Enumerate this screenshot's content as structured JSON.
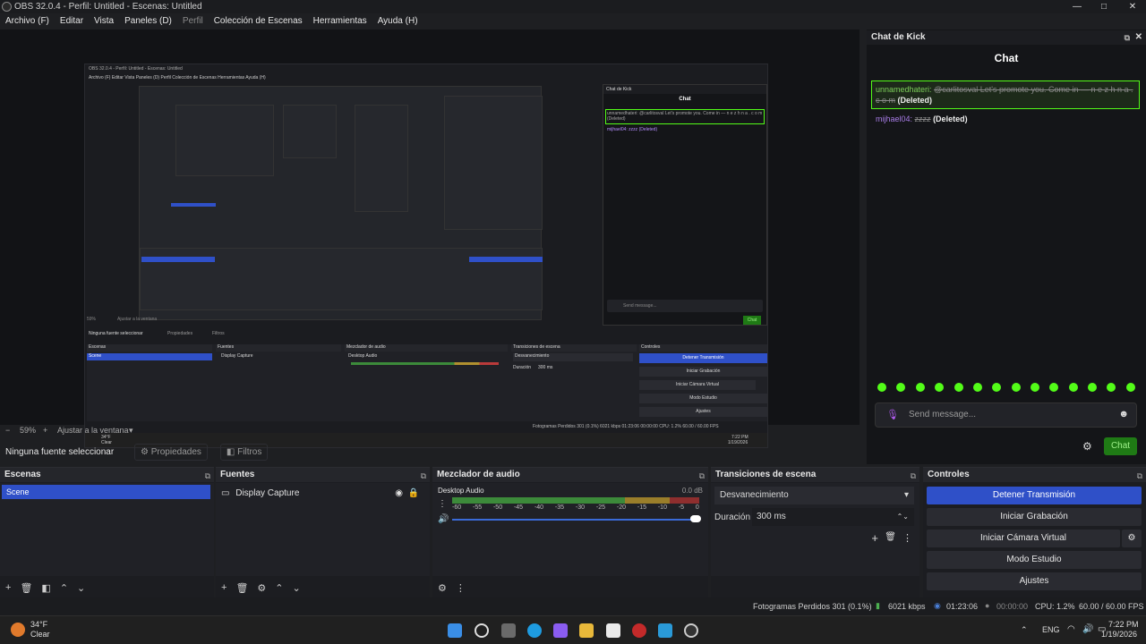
{
  "window": {
    "title": "OBS 32.0.4 - Perfil: Untitled - Escenas: Untitled",
    "minimize_icon": "minimize-icon",
    "maximize_icon": "maximize-icon",
    "close_icon": "close-icon"
  },
  "menu": {
    "archivo": "Archivo (F)",
    "editar": "Editar",
    "vista": "Vista",
    "paneles": "Paneles (D)",
    "perfil": "Perfil",
    "coleccion": "Colección de Escenas",
    "herramientas": "Herramientas",
    "ayuda": "Ayuda (H)"
  },
  "preview": {
    "zoom_label": "59%",
    "fit_label": "Ajustar a la ventana"
  },
  "source_toolbar": {
    "no_source": "Ninguna fuente seleccionar",
    "properties": "Propiedades",
    "filters": "Filtros"
  },
  "scenes": {
    "title": "Escenas",
    "items": [
      "Scene"
    ]
  },
  "sources": {
    "title": "Fuentes",
    "items": [
      "Display Capture"
    ]
  },
  "mixer": {
    "title": "Mezclador de audio",
    "channel": "Desktop Audio",
    "db": "0.0 dB",
    "ticks": [
      "-60",
      "-55",
      "-50",
      "-45",
      "-40",
      "-35",
      "-30",
      "-25",
      "-20",
      "-15",
      "-10",
      "-5",
      "0"
    ]
  },
  "transitions": {
    "title": "Transiciones de escena",
    "selected": "Desvanecimiento",
    "duration_label": "Duración",
    "duration_value": "300 ms"
  },
  "controls": {
    "title": "Controles",
    "stop_stream": "Detener Transmisión",
    "start_recording": "Iniciar Grabación",
    "virtual_cam": "Iniciar Cámara Virtual",
    "studio_mode": "Modo Estudio",
    "settings": "Ajustes"
  },
  "chat": {
    "dock_title": "Chat de Kick",
    "header": "Chat",
    "messages": [
      {
        "user": "unnamedhateri:",
        "text": "@carlitosval Let's promote you. Come in — n e z h n a . c o m",
        "tag": "(Deleted)"
      },
      {
        "user": "mijhael04:",
        "text": "zzzz",
        "tag": "(Deleted)"
      }
    ],
    "placeholder": "Send message...",
    "send_label": "Chat",
    "accent": "#53fc18"
  },
  "status": {
    "dropped": "Fotogramas Perdidos 301 (0.1%)",
    "bitrate": "6021 kbps",
    "live_time": "01:23:06",
    "rec_time": "00:00:00",
    "cpu": "CPU: 1.2%",
    "fps": "60.00 / 60.00 FPS"
  },
  "taskbar": {
    "temp": "34°F",
    "weather": "Clear",
    "lang": "ENG",
    "time": "7:22 PM",
    "date": "1/19/2026"
  },
  "nested": {
    "title": "OBS 32.0.4 - Perfil: Untitled - Escenas: Untitled",
    "menu": "Archivo (F)  Editar  Vista  Paneles (D)  Perfil  Colección de Escenas  Herramientas  Ayuda (H)",
    "chat_title": "Chat de Kick",
    "chat_header": "Chat",
    "chat_msg1": "unnamedhateri: @carlitosval Let's promote you. Come in — n e z h n a . c o m (Deleted)",
    "chat_msg2": "mijhael04: zzzz (Deleted)",
    "send": "Send message...",
    "chat_btn": "Chat",
    "no_source": "Ninguna fuente seleccionar",
    "props": "Propiedades",
    "filters": "Filtros",
    "scenes": "Escenas",
    "sources": "Fuentes",
    "mixer": "Mezclador de audio",
    "transitions": "Transiciones de escena",
    "controls": "Controles",
    "scene": "Scene",
    "display": "Display Capture",
    "desktop": "Desktop Audio",
    "fade": "Desvanecimiento",
    "duration": "Duración",
    "duration_value": "300 ms",
    "stop": "Detener Transmisión",
    "rec": "Iniciar Grabación",
    "vcam": "Iniciar Cámara Virtual",
    "studio": "Modo Estudio",
    "settings": "Ajustes",
    "status": "Fotogramas Perdidos 301 (0.1%)   6021 kbps   01:23:06   00:00:00   CPU: 1.2%   60.00 / 60.00 FPS",
    "zoom": "59%",
    "fit": "Ajustar a la ventana",
    "temp": "34°F",
    "weather": "Clear",
    "time": "7:22 PM",
    "date": "1/19/2026"
  }
}
